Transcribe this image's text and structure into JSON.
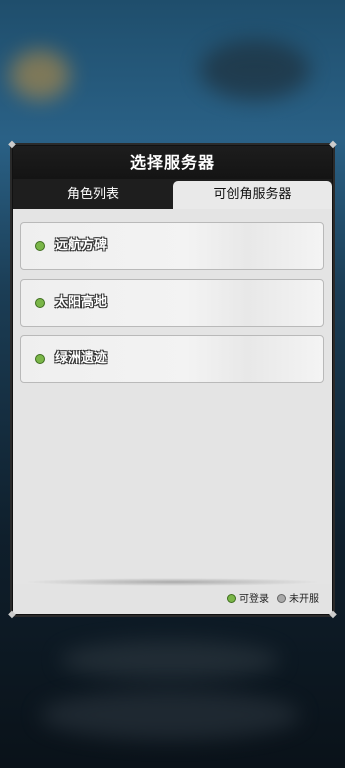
{
  "dialog": {
    "title": "选择服务器"
  },
  "tabs": [
    {
      "label": "角色列表",
      "active": false
    },
    {
      "label": "可创角服务器",
      "active": true
    }
  ],
  "servers": [
    {
      "name": "远航方碑",
      "status": "可登录"
    },
    {
      "name": "太阳高地",
      "status": "可登录"
    },
    {
      "name": "绿洲遗迹",
      "status": "可登录"
    }
  ],
  "legend": {
    "available": "可登录",
    "closed": "未开服"
  },
  "colors": {
    "available_dot": "#7ab648",
    "closed_dot": "#a9a9a9",
    "title_bar": "#1d1d1d"
  }
}
